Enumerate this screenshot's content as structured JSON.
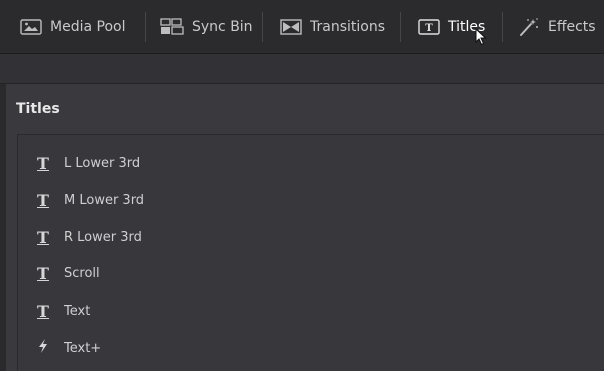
{
  "toolbar": {
    "tabs": [
      {
        "label": "Media Pool",
        "icon": "media-pool-icon"
      },
      {
        "label": "Sync Bin",
        "icon": "sync-bin-icon"
      },
      {
        "label": "Transitions",
        "icon": "transitions-icon"
      },
      {
        "label": "Titles",
        "icon": "titles-icon",
        "active": true
      },
      {
        "label": "Effects",
        "icon": "effects-wand-icon"
      }
    ]
  },
  "section": {
    "title": "Titles"
  },
  "titles_list": {
    "items": [
      {
        "label": "L Lower 3rd",
        "icon": "title-text-icon"
      },
      {
        "label": "M Lower 3rd",
        "icon": "title-text-icon"
      },
      {
        "label": "R Lower 3rd",
        "icon": "title-text-icon"
      },
      {
        "label": "Scroll",
        "icon": "title-text-icon"
      },
      {
        "label": "Text",
        "icon": "title-text-icon"
      },
      {
        "label": "Text+",
        "icon": "fusion-title-icon"
      }
    ]
  },
  "colors": {
    "toolbar_bg": "#2b2b2e",
    "panel_bg": "#38383c",
    "text": "#cfcfd2",
    "active_text": "#ffffff"
  }
}
